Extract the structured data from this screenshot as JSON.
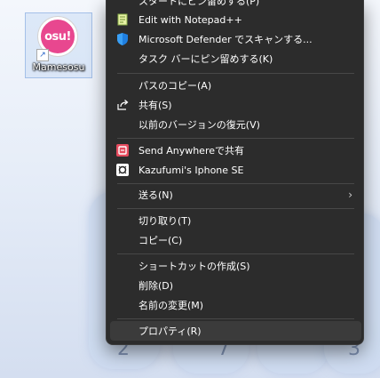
{
  "desktop": {
    "icon_label": "Mamesosu",
    "icon_logo_text": "osu!",
    "wallpaper_digits": [
      "2",
      "7",
      "3"
    ]
  },
  "menu": {
    "items": [
      {
        "label": "スタートにピン留めする(P)",
        "icon": "pin-icon"
      },
      {
        "label": "Edit with Notepad++",
        "icon": "notepadpp-icon"
      },
      {
        "label": "Microsoft Defender でスキャンする...",
        "icon": "defender-shield-icon"
      },
      {
        "label": "タスク バーにピン留めする(K)",
        "icon": ""
      },
      {
        "label": "パスのコピー(A)",
        "icon": ""
      },
      {
        "label": "共有(S)",
        "icon": "share-icon"
      },
      {
        "label": "以前のバージョンの復元(V)",
        "icon": ""
      },
      {
        "label": "Send Anywhereで共有",
        "icon": "send-anywhere-icon"
      },
      {
        "label": "Kazufumi's Iphone SE",
        "icon": "phone-icon"
      },
      {
        "label": "送る(N)",
        "icon": "",
        "submenu": true
      },
      {
        "label": "切り取り(T)",
        "icon": ""
      },
      {
        "label": "コピー(C)",
        "icon": ""
      },
      {
        "label": "ショートカットの作成(S)",
        "icon": ""
      },
      {
        "label": "削除(D)",
        "icon": ""
      },
      {
        "label": "名前の変更(M)",
        "icon": ""
      },
      {
        "label": "プロパティ(R)",
        "icon": "",
        "highlighted": true
      }
    ]
  },
  "colors": {
    "menu_bg": "#2c2c2c",
    "highlight_bg": "#3b3b3b",
    "text": "#ffffff",
    "accent_pink": "#e8478f"
  }
}
